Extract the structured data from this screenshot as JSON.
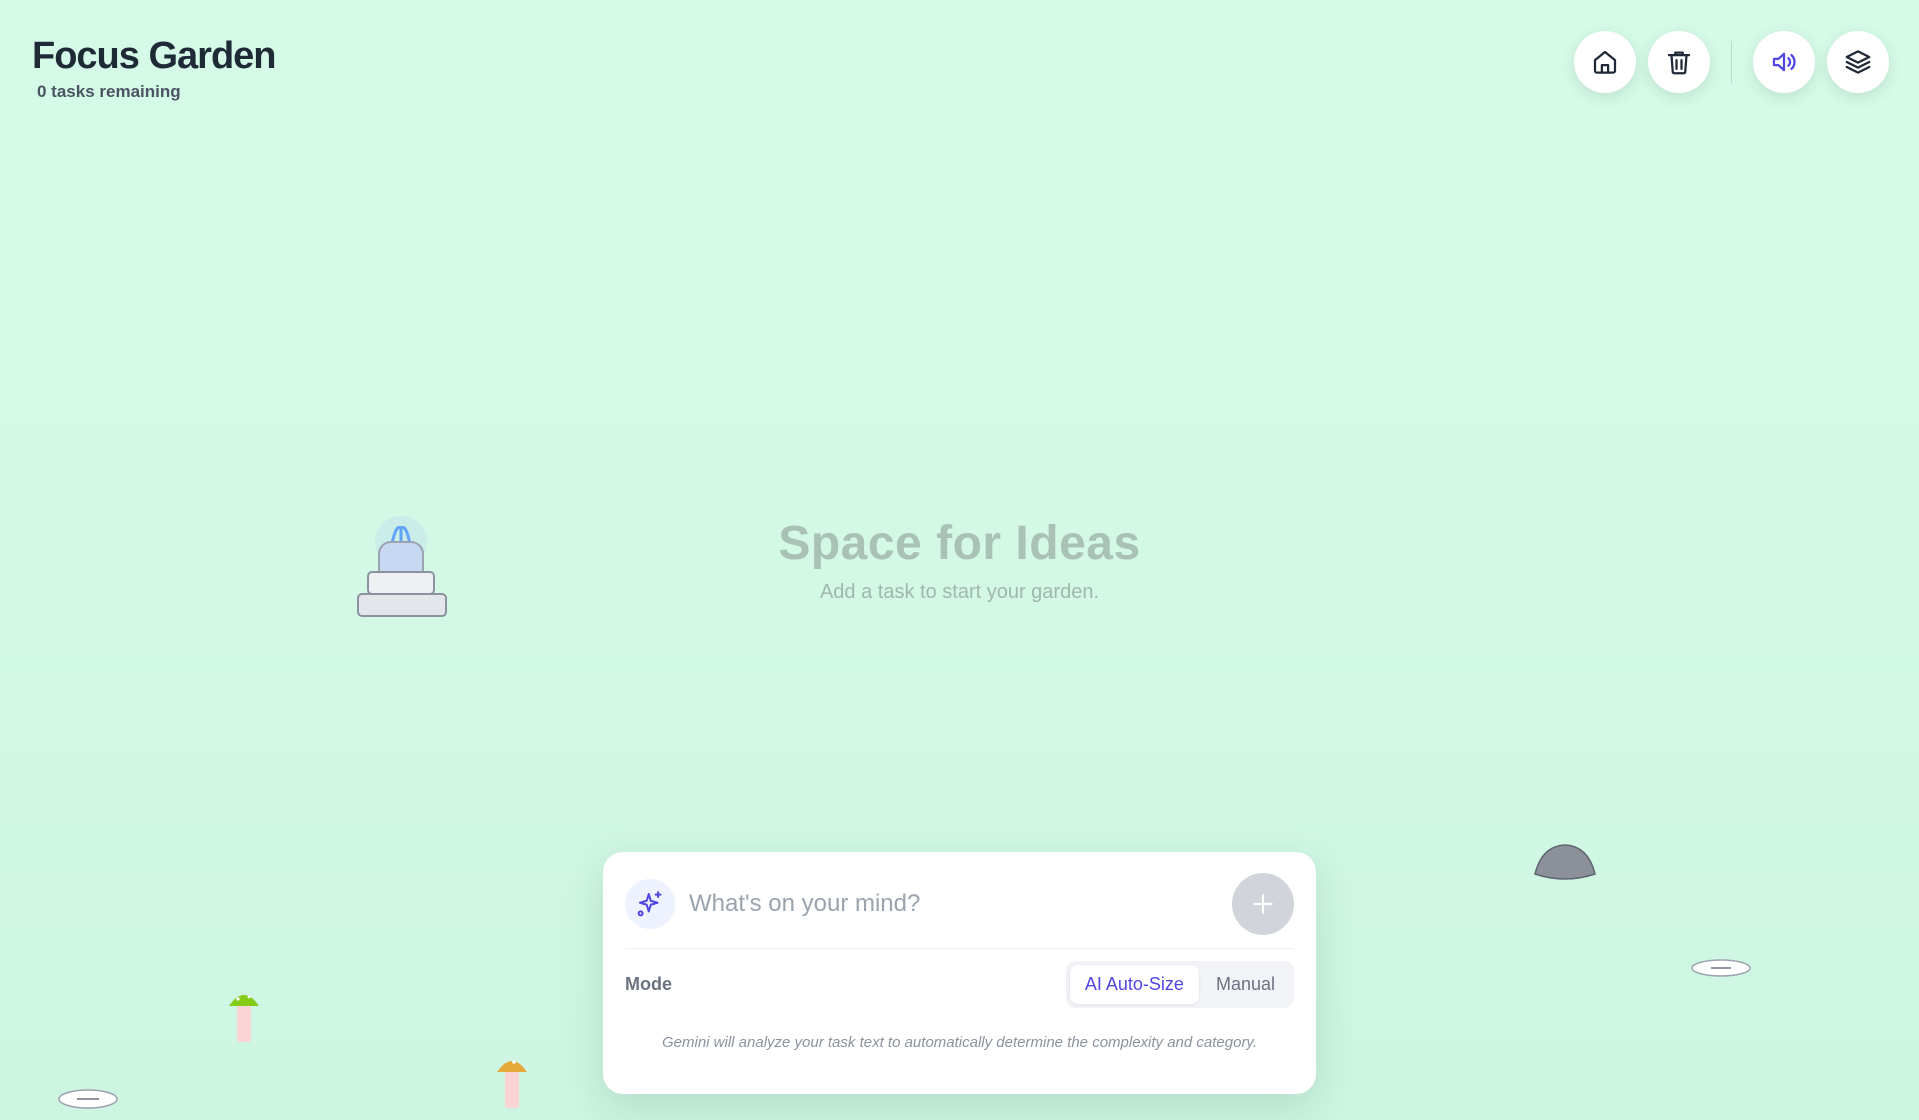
{
  "header": {
    "title": "Focus Garden",
    "tasks_remaining": "0 tasks remaining"
  },
  "toolbar": {
    "items": [
      {
        "icon": "home-icon",
        "label": "Home"
      },
      {
        "icon": "trash-icon",
        "label": "Clear"
      },
      {
        "icon": "volume-icon",
        "label": "Sound"
      },
      {
        "icon": "layers-icon",
        "label": "Layers"
      }
    ]
  },
  "empty_state": {
    "title": "Space for Ideas",
    "hint": "Add a task to start your garden."
  },
  "composer": {
    "placeholder": "What's on your mind?",
    "mode_label": "Mode",
    "modes": [
      "AI Auto-Size",
      "Manual"
    ],
    "selected_mode": "AI Auto-Size",
    "note": "Gemini will analyze your task text to automatically determine the complexity and category."
  },
  "colors": {
    "background": "#d6fae8",
    "accent": "#4f46e5",
    "title_text": "#1f2a37"
  }
}
